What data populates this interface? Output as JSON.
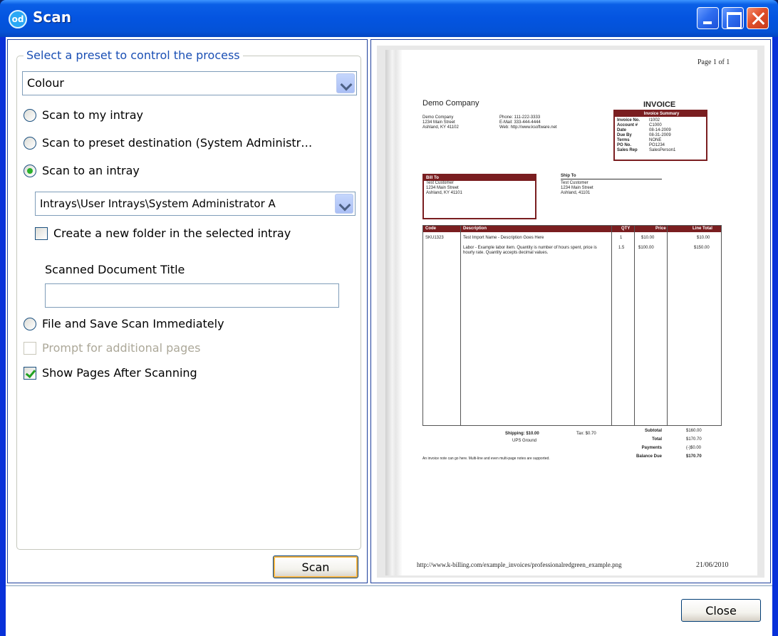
{
  "window": {
    "title": "Scan",
    "icon_text": "od"
  },
  "left": {
    "group_title": "Select a preset to control the process",
    "preset_select": "Colour",
    "options": {
      "my_intray": "Scan to my intray",
      "preset_destination": "Scan to preset destination (System Administr…",
      "an_intray": "Scan to an intray"
    },
    "intray_select": "Intrays\\User Intrays\\System Administrator A",
    "create_folder": "Create a new folder in the selected intray",
    "doc_title_label": "Scanned Document Title",
    "doc_title_value": "",
    "file_and_save": "File and Save Scan Immediately",
    "prompt_additional": "Prompt for additional pages",
    "show_pages": "Show Pages After Scanning",
    "scan_button": "Scan"
  },
  "preview": {
    "page_header": "Page 1 of 1",
    "company": "Demo Company",
    "company_lines": [
      "Demo Company",
      "1234 Main Street",
      "Ashland, KY 41102"
    ],
    "contact_lines": [
      "Phone:  111-222-3333",
      "E-Mail:  333-444-4444",
      "Web:  http://www.ksoftware.net"
    ],
    "invoice_title": "INVOICE",
    "summary_header": "Invoice Summary",
    "summary_labels": [
      "Invoice No.",
      "Account #",
      "Date",
      "Due By",
      "Terms",
      "PO No.",
      "Sales Rep"
    ],
    "summary_values": [
      "I1002",
      "C1000",
      "08-14-2009",
      "08-31-2009",
      "NONE",
      "PO1234",
      "SalesPerson1"
    ],
    "bill_to_header": "Bill To",
    "bill_to_lines": [
      "Test Customer",
      "1234 Main Street",
      "Ashland, KY 41101"
    ],
    "ship_to_header": "Ship To",
    "ship_to_lines": [
      "Test Customer",
      "1234 Main Street",
      "Ashland, 41101"
    ],
    "table_headers": [
      "Code",
      "Description",
      "QTY",
      "Price",
      "Line Total"
    ],
    "rows": [
      {
        "code": "SKU1323",
        "desc": "Test Import Name - Description Goes Here",
        "qty": "1",
        "price": "$10.00",
        "total": "$10.00"
      },
      {
        "code": "",
        "desc": "Labor - Example labor item. Quantity is number of hours spent, price is hourly rate. Quantity accepts decimal values.",
        "qty": "1.5",
        "price": "$100.00",
        "total": "$150.00"
      }
    ],
    "shipping_line": "Shipping: $10.00",
    "ship_method": "UPS Ground",
    "tax_line": "Tax: $0.70",
    "totals_labels": [
      "Subtotal",
      "Total",
      "Payments",
      "Balance Due"
    ],
    "totals_values": [
      "$160.00",
      "$170.70",
      "(-)$0.00",
      "$170.70"
    ],
    "note": "An invoice note can go here. Multi-line and even multi-page notes are supported.",
    "footer_url": "http://www.k-billing.com/example_invoices/professionalredgreen_example.png",
    "footer_date": "21/06/2010"
  },
  "footer": {
    "close_button": "Close"
  }
}
